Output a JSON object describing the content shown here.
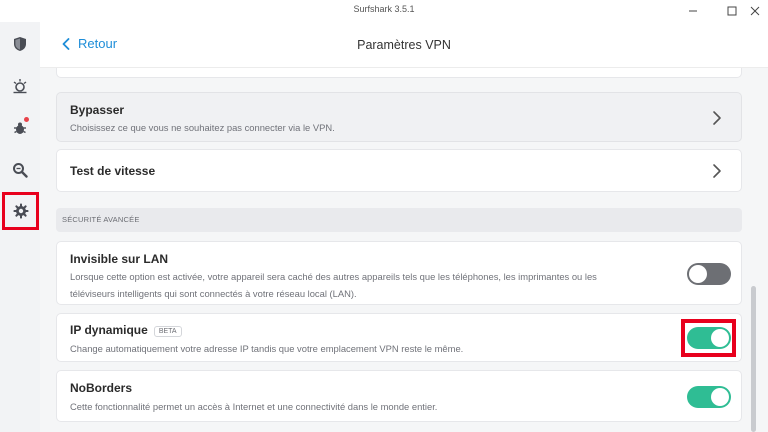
{
  "window": {
    "title": "Surfshark 3.5.1"
  },
  "sidebar": {
    "items": [
      {
        "name": "vpn",
        "icon": "shield-icon"
      },
      {
        "name": "alert",
        "icon": "bug-icon"
      },
      {
        "name": "antivirus",
        "icon": "bug-icon",
        "notification": true
      },
      {
        "name": "search",
        "icon": "search-icon"
      },
      {
        "name": "settings",
        "icon": "gear-icon",
        "active": true
      }
    ]
  },
  "header": {
    "back_label": "Retour",
    "title": "Paramètres VPN"
  },
  "settings": {
    "bypass": {
      "title": "Bypasser",
      "description": "Choisissez ce que vous ne souhaitez pas connecter via le VPN."
    },
    "speed_test": {
      "title": "Test de vitesse"
    },
    "advanced_security": {
      "header": "SÉCURITÉ AVANCÉE",
      "invisible_lan": {
        "title": "Invisible sur LAN",
        "description_line1": "Lorsque cette option est activée, votre appareil sera caché des autres appareils tels que les téléphones, les imprimantes ou les",
        "description_line2": "téléviseurs intelligents qui sont connectés à votre réseau local (LAN).",
        "enabled": false
      },
      "dynamic_ip": {
        "title": "IP dynamique",
        "badge": "BETA",
        "description": "Change automatiquement votre adresse IP tandis que votre emplacement VPN reste le même.",
        "enabled": true
      },
      "noborders": {
        "title": "NoBorders",
        "description": "Cette fonctionnalité permet un accès à Internet et une connectivité dans le monde entier.",
        "enabled": true
      }
    }
  },
  "colors": {
    "accent": "#1d8dd8",
    "toggle_on": "#2fbd94",
    "toggle_off": "#6d6f74",
    "highlight": "#e8001d"
  }
}
